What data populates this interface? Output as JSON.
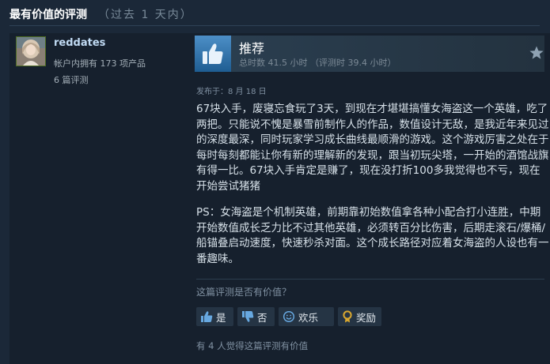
{
  "section": {
    "title": "最有价值的评测",
    "subtitle": "（过去 1 天内）"
  },
  "author": {
    "name": "reddates",
    "products_owned": "帐户内拥有 173 项产品",
    "review_count": "6 篇评测"
  },
  "verdict": {
    "title": "推荐",
    "hours": "总时数 41.5 小时 （评测时 39.4 小时）"
  },
  "posted": "发布于：8 月 18 日",
  "review": {
    "paragraphs": [
      "67块入手，废寝忘食玩了3天，到现在才堪堪搞懂女海盗这一个英雄，吃了两把。只能说不愧是暴雪前制作人的作品，数值设计无敌，是我近年来见过的深度最深，同时玩家学习成长曲线最顺滑的游戏。这个游戏厉害之处在于每时每刻都能让你有新的理解新的发现，跟当初玩尖塔，一开始的酒馆战旗有得一比。67块入手肯定是赚了，现在没打折100多我觉得也不亏，现在开始尝试猪猪",
      "PS：女海盗是个机制英雄，前期靠初始数值拿各种小配合打小连胜，中期开始数值成长乏力比不过其他英雄，必须转百分比伤害，后期走滚石/爆桶/船锚叠启动速度，快速秒杀对面。这个成长路径对应着女海盗的人设也有一番趣味。"
    ]
  },
  "helpful": {
    "question": "这篇评测是否有价值？",
    "yes": "是",
    "no": "否",
    "funny": "欢乐",
    "award": "奖励",
    "count_text": "有 4 人觉得这篇评测有价值"
  },
  "colors": {
    "background": "#1b2838",
    "card": "#16202d",
    "thumb_blue": "#4d8fc7",
    "award_gold": "#d9a72f"
  },
  "icons": {
    "verdict": "thumbs-up-icon",
    "favorite": "star-icon",
    "yes": "thumbs-up-icon",
    "no": "thumbs-down-icon",
    "funny": "smiley-icon",
    "award": "award-icon"
  }
}
